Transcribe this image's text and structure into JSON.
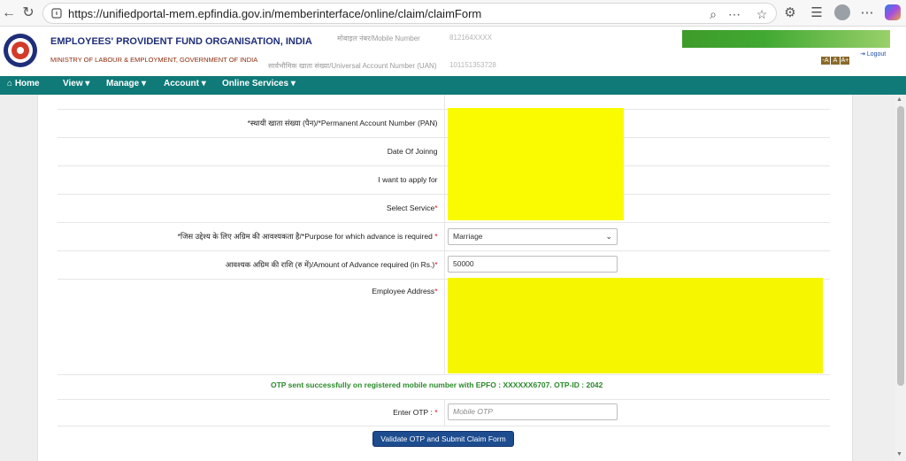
{
  "browser": {
    "url": "https://unifiedportal-mem.epfindia.gov.in/memberinterface/online/claim/claimForm"
  },
  "header": {
    "org_name": "EMPLOYEES' PROVIDENT FUND ORGANISATION, INDIA",
    "ministry": "MINISTRY OF LABOUR & EMPLOYMENT, GOVERNMENT OF INDIA",
    "mobile_label": "मोबाइल नंबर/Mobile Number",
    "mobile_value": "812164XXXX",
    "uan_label": "सार्वभौमिक खाता संख्या/Universal Account Number (UAN)",
    "uan_value": "101151353728",
    "font_buttons": [
      "-A",
      "A",
      "A+"
    ],
    "logout": "Logout"
  },
  "nav": {
    "home": "Home",
    "view": "View",
    "manage": "Manage",
    "account": "Account",
    "online_services": "Online Services"
  },
  "form": {
    "pan_label": "*स्थायी खाता संख्या (पैन)/*Permanent Account Number (PAN)",
    "doj_label": "Date Of Joinng",
    "apply_label": "I want to apply for",
    "service_label": "Select Service",
    "purpose_label": "*जिस उद्देश्य के लिए अग्रिम की आवश्यकता है/*Purpose for which advance is required",
    "purpose_value": "Marriage",
    "amount_label": "आवश्यक अग्रिम की राशि (रु में)/Amount of Advance required (in Rs.)",
    "amount_value": "50000",
    "address_label": "Employee Address",
    "otp_message": "OTP sent successfully on registered mobile number with EPFO : XXXXXX6707. OTP-ID : 2042",
    "otp_label": "Enter OTP :",
    "otp_placeholder": "Mobile OTP",
    "submit_label": "Validate OTP and Submit Claim Form",
    "required_mark": "*"
  },
  "colors": {
    "nav_bg": "#0f7a78",
    "submit_bg": "#1d4c8f",
    "success_text": "#2a8a2a",
    "redaction": "#fafa00"
  }
}
